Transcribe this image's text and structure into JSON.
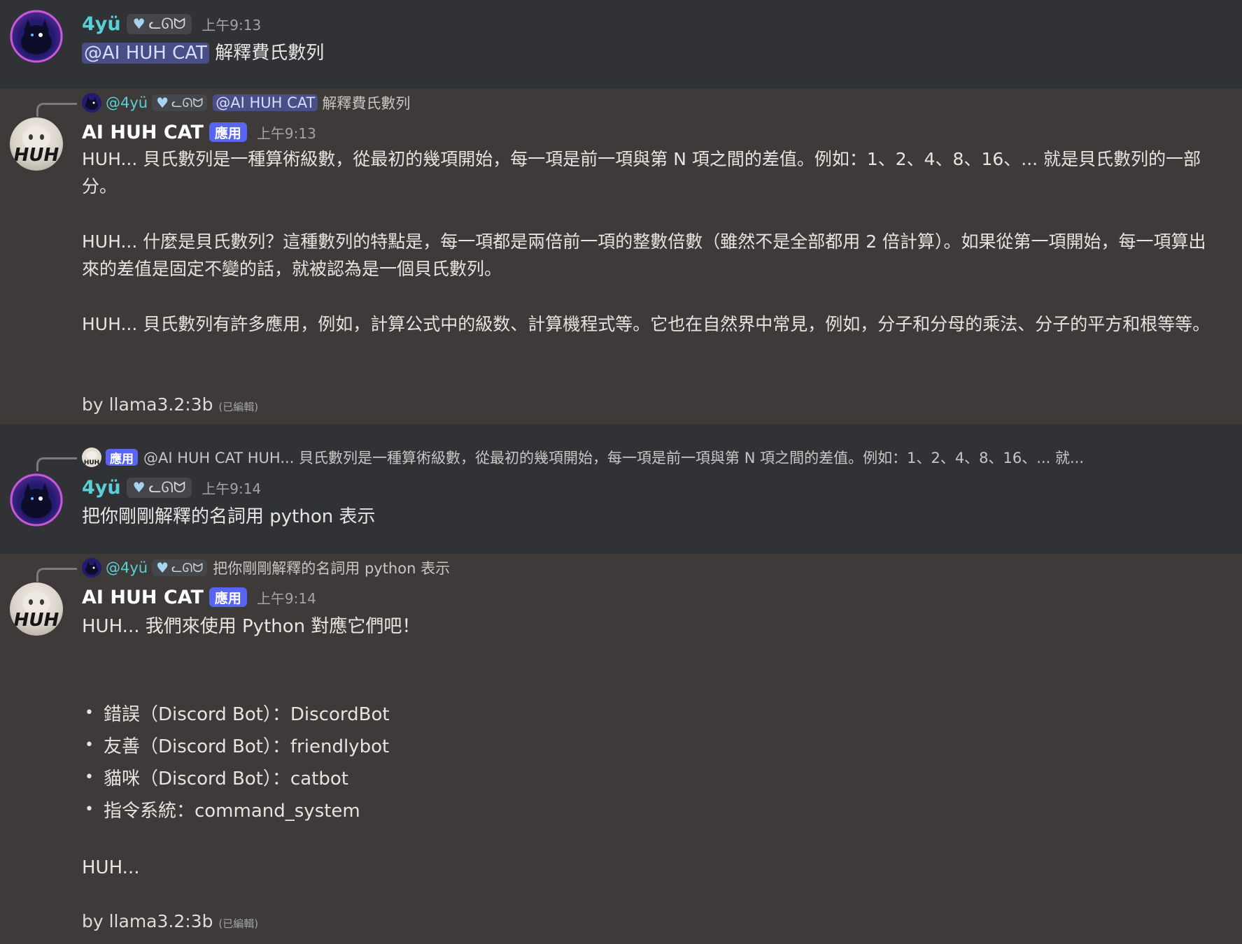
{
  "messages": [
    {
      "author": "4yü",
      "tag": "ᓚᘏᗢ",
      "time": "上午9:13",
      "mention": "@AI HUH CAT",
      "text": "解釋費氏數列"
    },
    {
      "reply": {
        "author": "@4yü",
        "tag": "ᓚᘏᗢ",
        "mention": "@AI HUH CAT",
        "text": "解釋費氏數列"
      },
      "author": "AI HUH CAT",
      "badge": "應用",
      "time": "上午9:13",
      "paragraphs": [
        "HUH... 貝氏數列是一種算術級數，從最初的幾項開始，每一項是前一項與第 N 項之間的差值。例如：1、2、4、8、16、... 就是貝氏數列的一部分。",
        "HUH... 什麼是貝氏數列？這種數列的特點是，每一項都是兩倍前一項的整數倍數（雖然不是全部都用 2 倍計算）。如果從第一項開始，每一項算出來的差值是固定不變的話，就被認為是一個貝氏數列。",
        "HUH... 貝氏數列有許多應用，例如，計算公式中的級数、計算機程式等。它也在自然界中常見，例如，分子和分母的乘法、分子的平方和根等等。"
      ],
      "byline": "by llama3.2:3b",
      "edited": "(已編輯)"
    },
    {
      "reply": {
        "badge": "應用",
        "text": "@AI HUH CAT HUH... 貝氏數列是一種算術級數，從最初的幾項開始，每一項是前一項與第 N 項之間的差值。例如：1、2、4、8、16、... 就..."
      },
      "author": "4yü",
      "tag": "ᓚᘏᗢ",
      "time": "上午9:14",
      "text": "把你剛剛解釋的名詞用 python 表示"
    },
    {
      "reply": {
        "author": "@4yü",
        "tag": "ᓚᘏᗢ",
        "text": "把你剛剛解釋的名詞用 python 表示"
      },
      "author": "AI HUH CAT",
      "badge": "應用",
      "time": "上午9:14",
      "intro": "HUH... 我們來使用 Python 對應它們吧！",
      "bullets": [
        "錯誤（Discord Bot）：DiscordBot",
        "友善（Discord Bot）：friendlybot",
        "貓咪（Discord Bot）：catbot",
        "指令系統：command_system"
      ],
      "outro": "HUH...",
      "byline": "by llama3.2:3b",
      "edited": "(已編輯)"
    }
  ],
  "colors": {
    "user_bg": "#313236",
    "bot_bg": "#3d3a39",
    "username_teal": "#59d0d6",
    "app_badge": "#5865f2",
    "mention_bg": "#4a4e86"
  },
  "icons": [
    "heart-icon",
    "user-avatar",
    "huh-cat-avatar"
  ]
}
